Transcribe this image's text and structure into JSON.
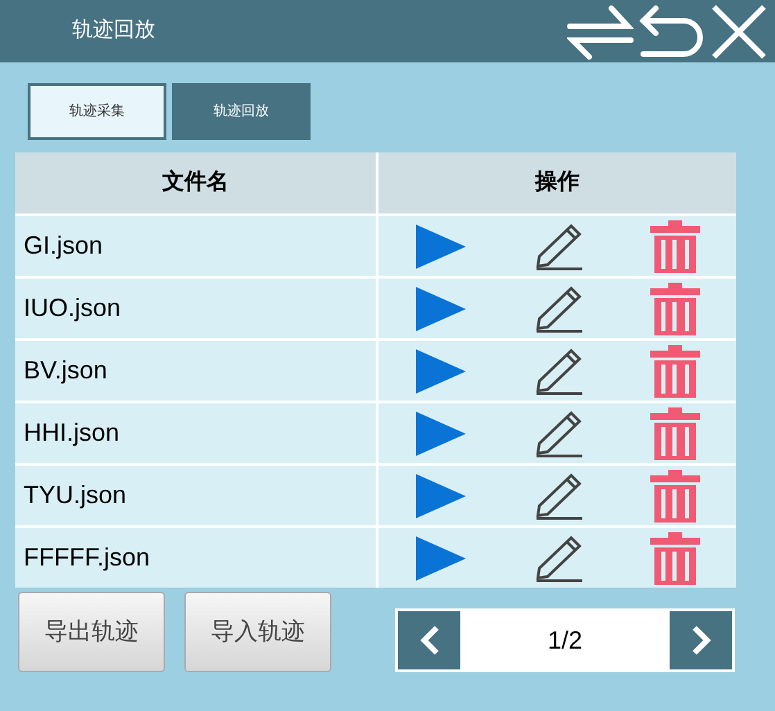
{
  "window": {
    "title": "轨迹回放"
  },
  "tabs": [
    {
      "label": "轨迹采集",
      "selected": false
    },
    {
      "label": "轨迹回放",
      "selected": true
    }
  ],
  "table": {
    "columns": [
      "文件名",
      "操作"
    ],
    "rows": [
      {
        "file": "GI.json"
      },
      {
        "file": "IUO.json"
      },
      {
        "file": "BV.json"
      },
      {
        "file": "HHI.json"
      },
      {
        "file": "TYU.json"
      },
      {
        "file": "FFFFF.json"
      }
    ]
  },
  "buttons": [
    "导出轨迹",
    "导入轨迹"
  ],
  "pager": {
    "page": "1/2"
  }
}
